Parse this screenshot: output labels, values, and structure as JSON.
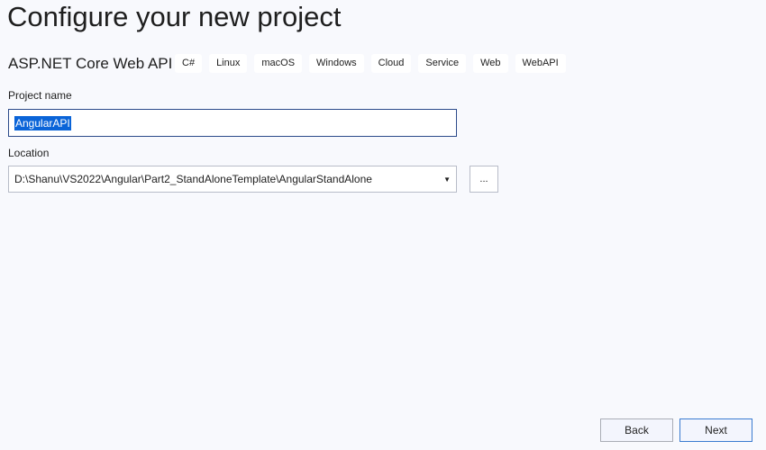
{
  "header": {
    "title": "Configure your new project",
    "template_name": "ASP.NET Core Web API",
    "tags": [
      "C#",
      "Linux",
      "macOS",
      "Windows",
      "Cloud",
      "Service",
      "Web",
      "WebAPI"
    ]
  },
  "form": {
    "project_name_label": "Project name",
    "project_name_value": "AngularAPI",
    "location_label": "Location",
    "location_value": "D:\\Shanu\\VS2022\\Angular\\Part2_StandAloneTemplate\\AngularStandAlone",
    "browse_label": "...",
    "dropdown_icon": "caret-down-icon"
  },
  "footer": {
    "back_label": "Back",
    "next_label": "Next"
  }
}
